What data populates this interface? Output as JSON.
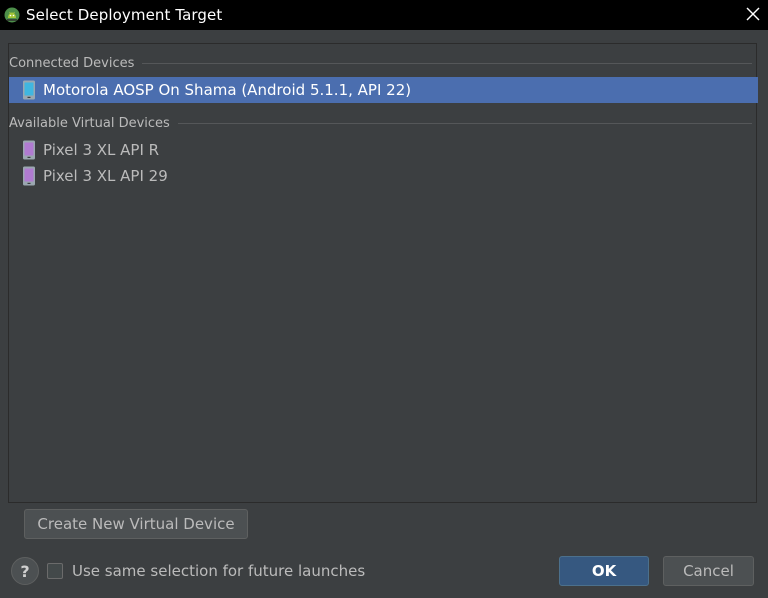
{
  "window": {
    "title": "Select Deployment Target",
    "icon": "android-studio-icon",
    "close_icon": "close-icon"
  },
  "groups": {
    "connected": {
      "label": "Connected Devices",
      "devices": [
        {
          "label": "Motorola AOSP On Shama (Android 5.1.1, API 22)",
          "icon": "physical-phone-icon",
          "selected": true
        }
      ]
    },
    "virtual": {
      "label": "Available Virtual Devices",
      "devices": [
        {
          "label": "Pixel 3 XL API R",
          "icon": "virtual-phone-icon",
          "selected": false
        },
        {
          "label": "Pixel 3 XL API 29",
          "icon": "virtual-phone-icon",
          "selected": false
        }
      ]
    }
  },
  "buttons": {
    "create_new_virtual_device": "Create New Virtual Device",
    "ok": "OK",
    "cancel": "Cancel",
    "help": "?"
  },
  "options": {
    "same_selection_label": "Use same selection for future launches",
    "same_selection_checked": false
  },
  "colors": {
    "background": "#3c3f41",
    "titlebar": "#000000",
    "selection": "#4b6eaf",
    "ok_button": "#365880",
    "text": "#bbbbbb"
  }
}
